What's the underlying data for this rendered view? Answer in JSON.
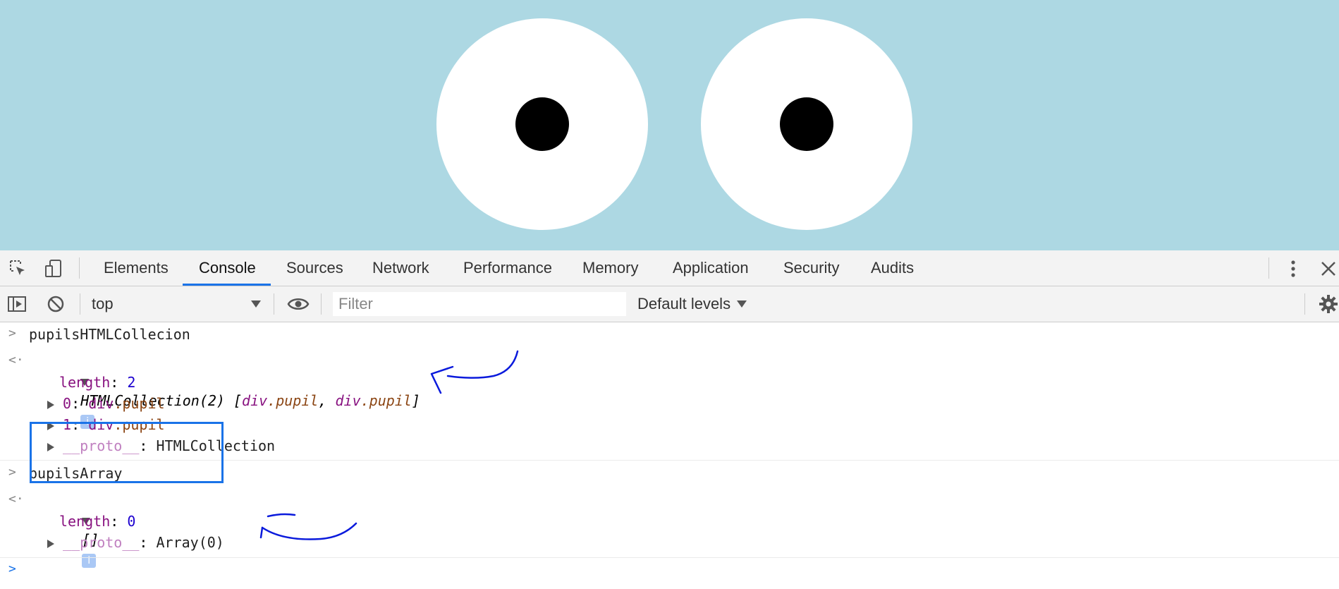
{
  "devtools": {
    "tabs": [
      "Elements",
      "Console",
      "Sources",
      "Network",
      "Performance",
      "Memory",
      "Application",
      "Security",
      "Audits"
    ],
    "active_tab": "Console",
    "icons": [
      "inspect-element-icon",
      "device-toolbar-icon",
      "more-menu-icon",
      "close-icon"
    ]
  },
  "console_toolbar": {
    "context": "top",
    "filter_placeholder": "Filter",
    "levels": "Default levels",
    "icons": [
      "sidebar-toggle-icon",
      "clear-console-icon",
      "live-expression-eye-icon",
      "settings-gear-icon"
    ]
  },
  "console": {
    "entry1": {
      "input": "pupilsHTMLCollecion",
      "result_head": "HTMLCollection(2) [",
      "item_a_tag": "div",
      "item_a_cls": ".pupil",
      "comma": ", ",
      "item_b_tag": "div",
      "item_b_cls": ".pupil",
      "result_tail": "]",
      "length_key": "length",
      "length_val": "2",
      "item0_key": "0",
      "item0_tag": "div",
      "item0_cls": ".pupil",
      "item1_key": "1",
      "item1_tag": "div",
      "item1_cls": ".pupil",
      "proto_key": "__proto__",
      "proto_val": "HTMLCollection"
    },
    "entry2": {
      "input": "pupilsArray",
      "result": "[]",
      "length_key": "length",
      "length_val": "0",
      "proto_key": "__proto__",
      "proto_val": "Array(0)"
    },
    "info_badge": "i",
    "colon": ": "
  },
  "colors": {
    "page_background": "#add8e3",
    "annotation_ink": "#0a1adc",
    "accent": "#1a73e8"
  }
}
